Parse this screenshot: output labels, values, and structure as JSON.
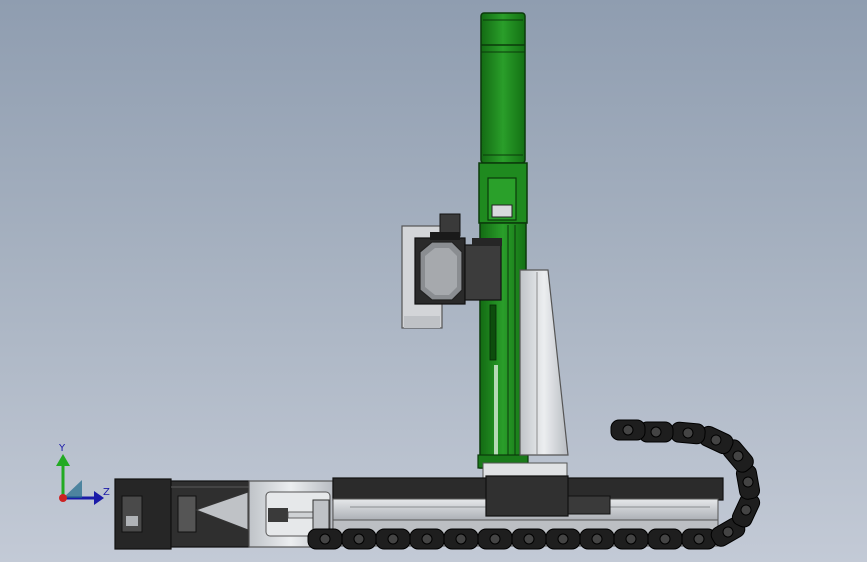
{
  "view": {
    "background_top": "#8f9db0",
    "background_bottom": "#c3cad6"
  },
  "triad": {
    "y_label": "Y",
    "z_label": "Z",
    "y_color": "#22aa22",
    "z_color": "#1a1aa8",
    "origin_color": "#cc2222"
  },
  "model": {
    "vertical_actuator_color": "#1f8a1f",
    "metal_color": "#d8dadd",
    "dark_color": "#2c2c2c",
    "cable_chain_color": "#1e1e1e"
  }
}
